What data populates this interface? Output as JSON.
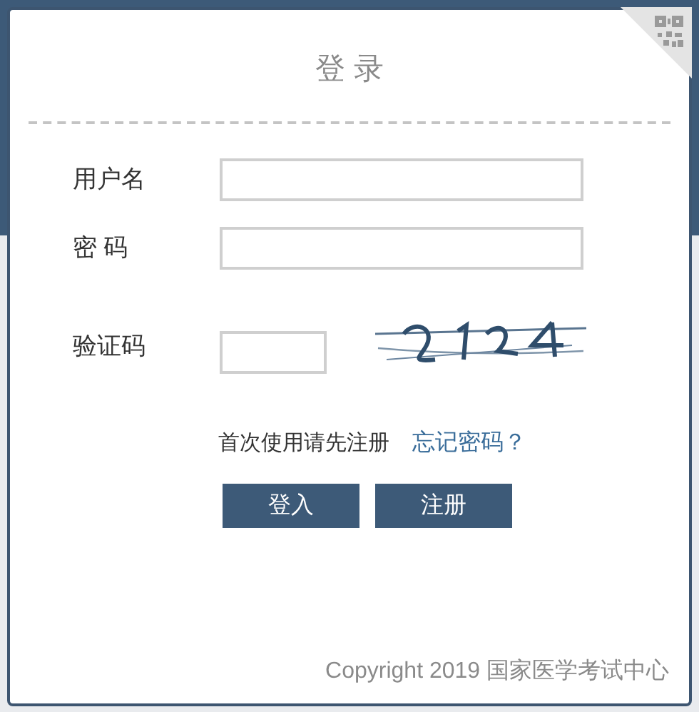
{
  "dialog": {
    "title": "登 录",
    "fields": [
      {
        "label": "用户名",
        "kind": "wide"
      },
      {
        "label": "密 码",
        "kind": "wide"
      },
      {
        "label": "验证码",
        "kind": "captcha"
      }
    ],
    "hint": "首次使用请先注册",
    "forgot_link": "忘记密码？",
    "buttons": [
      "登入",
      "注册"
    ],
    "footer": "Copyright 2019 国家医学考试中心"
  }
}
